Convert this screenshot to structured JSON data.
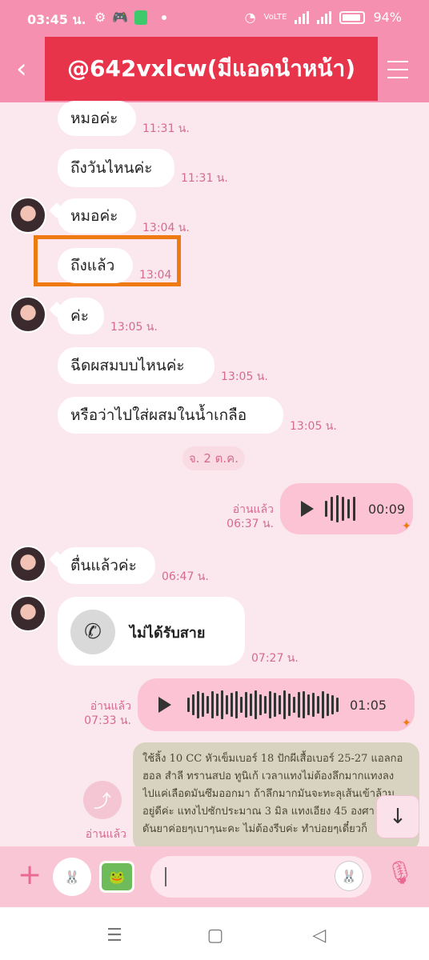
{
  "status_bar": {
    "time": "03:45 น.",
    "battery": "94%",
    "icons": [
      "settings-icon",
      "game-icon",
      "app-icon",
      "dot-icon",
      "wifi-icon",
      "volte-icon",
      "signal-icon",
      "signal-icon",
      "battery-icon"
    ]
  },
  "header": {
    "title": "@642vxlcw(มีแอดนำหน้า)",
    "back_icon": "back-arrow-icon",
    "menu_icon": "menu-icon"
  },
  "messages": [
    {
      "text": "หมอค่ะ",
      "time": "11:31 น."
    },
    {
      "text": "ถึงวันไหนค่ะ",
      "time": "11:31 น."
    },
    {
      "text": "หมอค่ะ",
      "time": "13:04 น."
    },
    {
      "text": "ถึงแล้ว",
      "time": "13:04"
    },
    {
      "text": "ค่ะ",
      "time": "13:05 น."
    },
    {
      "text": "ฉีดผสมบบไหนค่ะ",
      "time": "13:05 น."
    },
    {
      "text": "หรือว่าไปใส่ผสมในน้ำเกลือ",
      "time": "13:05 น."
    }
  ],
  "date_separator": "จ. 2 ต.ค.",
  "voice1": {
    "read": "อ่านแล้ว",
    "time": "06:37 น.",
    "duration": "00:09"
  },
  "msg_after": {
    "text": "ตื่นแล้วค่ะ",
    "time": "06:47 น."
  },
  "missed_call": {
    "text": "ไม่ได้รับสาย",
    "time": "07:27 น."
  },
  "voice2": {
    "read": "อ่านแล้ว",
    "time": "07:33 น.",
    "duration": "01:05"
  },
  "image_msg": {
    "read": "อ่านแล้ว",
    "lines": [
      "ใช้ลิ้ง 10 CC หัวเข็มเบอร์ 18 ปักผีเสื้อเบอร์ 25-27 แอลกอ",
      "ฮอล  สำลี ทรานสปอ ทูนิเก้  เวลาแทงไม่ต้องลึกมากแทงลง",
      "ไปแค่เลือดมันซึมออกมา ถ้าลึกมากมันจะทะลุเส้นเข้าล้าม",
      "อยู่ดีค่ะ แทงไปซักประมาณ 3 มิล แทงเอียง 45 องศา",
      "ดันยาค่อยๆเบาๆนะคะ ไม่ต้องรีบค่ะ ทำบ่อยๆเดี๋ยวก็"
    ]
  },
  "input": {
    "placeholder": ""
  },
  "colors": {
    "header": "#f590b0",
    "title_box": "#e8344a",
    "highlight": "#f07a12",
    "background": "#fbe8ee"
  }
}
